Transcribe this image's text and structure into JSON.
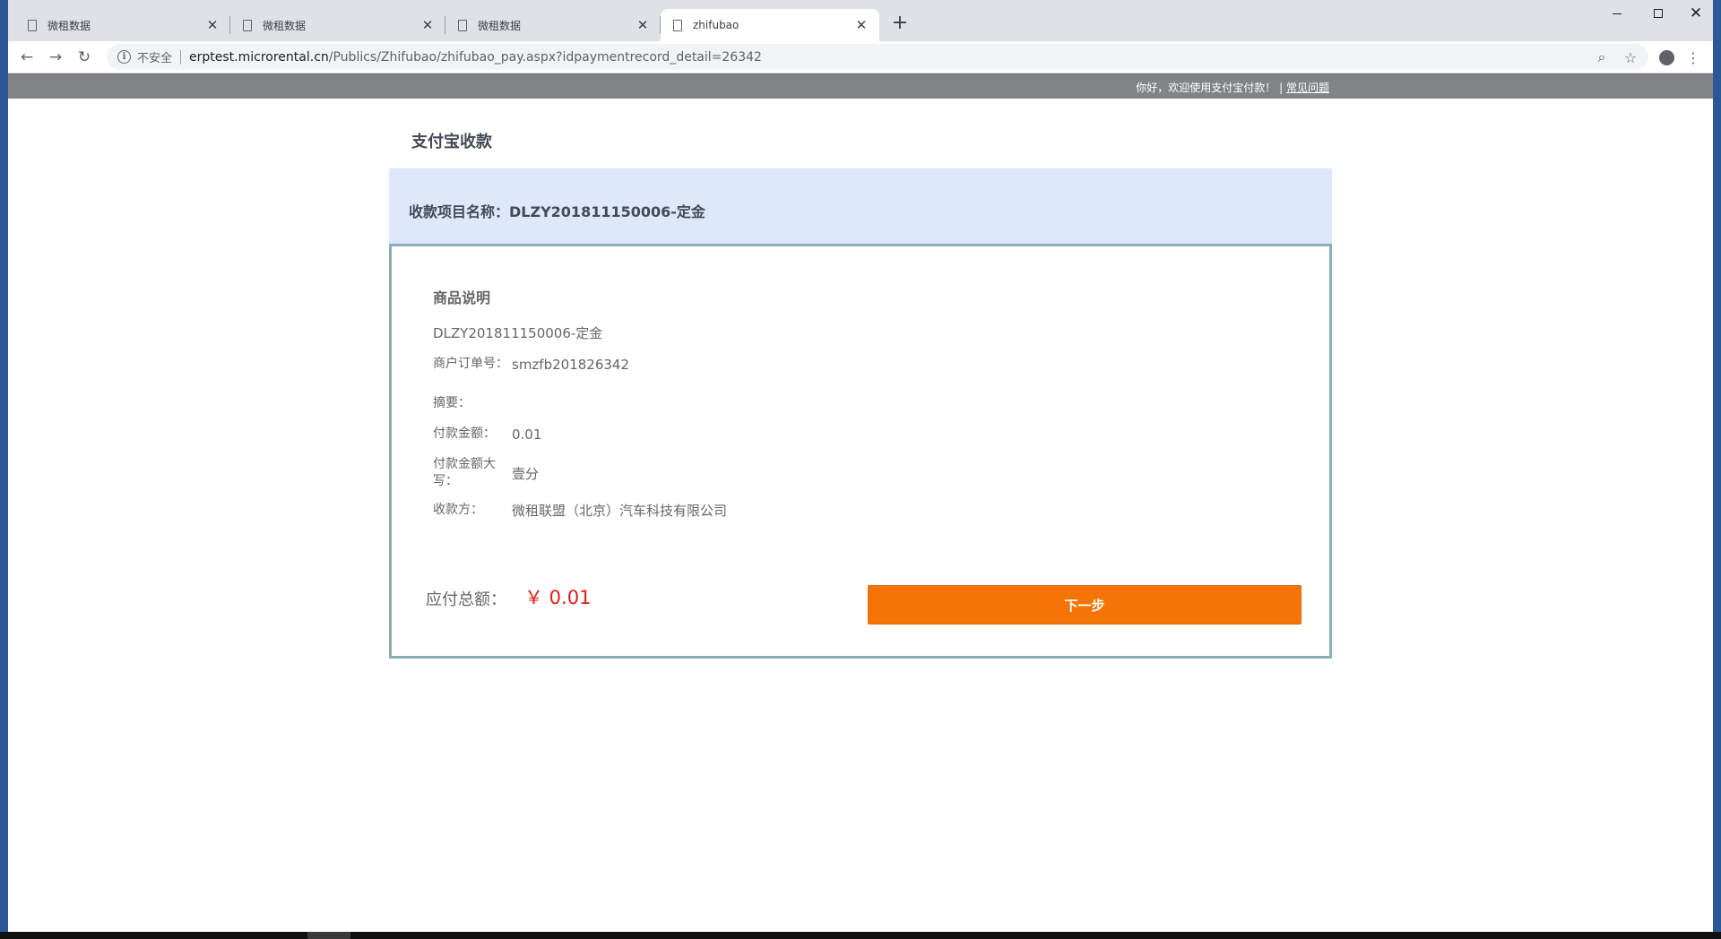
{
  "browser": {
    "tabs": [
      {
        "title": "微租数据",
        "active": false
      },
      {
        "title": "微租数据",
        "active": false
      },
      {
        "title": "微租数据",
        "active": false
      },
      {
        "title": "zhifubao",
        "active": true
      }
    ],
    "address": {
      "security_label": "不安全",
      "host": "erptest.microrental.cn",
      "path": "/Publics/Zhifubao/zhifubao_pay.aspx?idpaymentrecord_detail=26342"
    },
    "icons": {
      "back": "arrow-left",
      "forward": "arrow-right",
      "reload": "reload",
      "zoom": "zoom",
      "bookmark": "star",
      "profile": "account",
      "menu": "more-vertical"
    }
  },
  "page": {
    "topbar": {
      "welcome": "你好，欢迎使用支付宝付款！ |",
      "faq_link": "常见问题"
    },
    "heading": "支付宝收款",
    "project_name": "收款项目名称：DLZY201811150006-定金",
    "card": {
      "title": "商品说明",
      "description": "DLZY201811150006-定金",
      "fields": [
        {
          "label": "商户订单号：",
          "value": "smzfb201826342"
        },
        {
          "label": "摘要：",
          "value": ""
        },
        {
          "label": "付款金额：",
          "value": "0.01"
        },
        {
          "label": "付款金额大写：",
          "value": "壹分"
        },
        {
          "label": "收款方：",
          "value": "微租联盟（北京）汽车科技有限公司"
        }
      ],
      "total_label": "应付总额：",
      "total_amount": "￥ 0.01",
      "next_button": "下一步"
    },
    "colors": {
      "topbar": "#808486",
      "band": "#dde8fb",
      "card_border": "#8ab0b6",
      "button": "#f47506",
      "amount": "#e31b1b"
    }
  }
}
